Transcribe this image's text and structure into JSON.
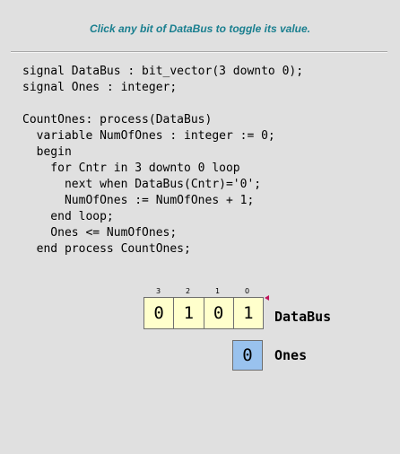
{
  "header": {
    "instruction": "Click any bit of DataBus to toggle its value."
  },
  "code": {
    "lines": [
      "signal DataBus : bit_vector(3 downto 0);",
      "signal Ones : integer;",
      "",
      "CountOnes: process(DataBus)",
      "  variable NumOfOnes : integer := 0;",
      "  begin",
      "    for Cntr in 3 downto 0 loop",
      "      next when DataBus(Cntr)='0';",
      "      NumOfOnes := NumOfOnes + 1;",
      "    end loop;",
      "    Ones <= NumOfOnes;",
      "  end process CountOnes;"
    ]
  },
  "databus": {
    "label": "DataBus",
    "indices": [
      "3",
      "2",
      "1",
      "0"
    ],
    "bits": [
      "0",
      "1",
      "0",
      "1"
    ],
    "cell_color": "#ffffcc",
    "pointer_color": "#c0145a",
    "pointer_icon": "left-pointing-triangle"
  },
  "ones": {
    "label": "Ones",
    "value": "0",
    "cell_color": "#99c2ee"
  },
  "colors": {
    "background": "#e0e0e0",
    "instruction_text": "#1a7f8f"
  }
}
